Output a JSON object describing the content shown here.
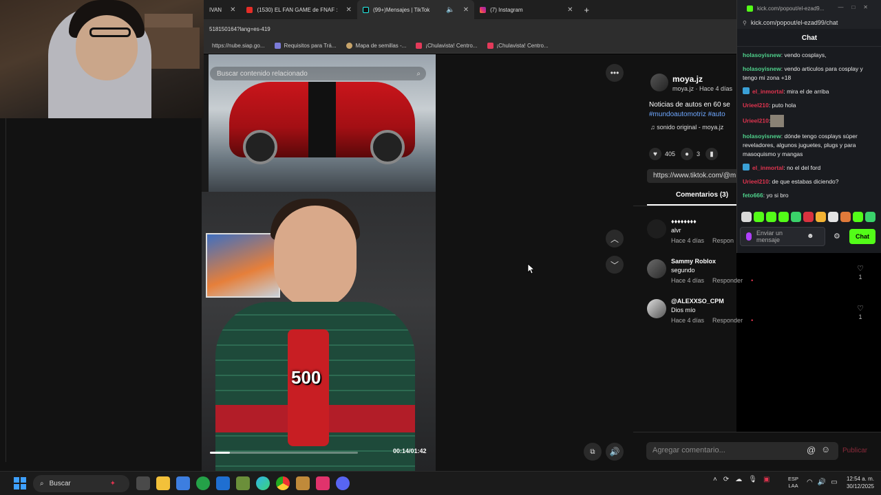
{
  "browser": {
    "tabs": [
      {
        "label": "IVAN",
        "icon": "tab-fragment-icon"
      },
      {
        "label": "(1530) EL FAN GAME de FNAF :",
        "icon": "youtube-icon"
      },
      {
        "label": "(99+)Mensajes | TikTok",
        "icon": "tiktok-icon",
        "active": true
      },
      {
        "label": "(7) Instagram",
        "icon": "instagram-icon"
      }
    ],
    "new_tab": "+",
    "address": "518150164?lang=es-419",
    "bookmarks": [
      {
        "label": "https://nube.siap.go..."
      },
      {
        "label": "Requisitos para Trá..."
      },
      {
        "label": "Mapa de semillas -..."
      },
      {
        "label": "¡Chulavista! Centro..."
      },
      {
        "label": "¡Chulavista! Centro..."
      }
    ]
  },
  "video": {
    "search_placeholder": "Buscar contenido relacionado",
    "overlay_number": "500",
    "time": "00:14/01:42",
    "progress": 0.137
  },
  "post": {
    "author": "moya.jz",
    "author_sub": "moya.jz · Hace 4 días",
    "description": "Noticias de autos en 60 se",
    "hashtags": "#mundoautomotriz #auto",
    "sound": "♫  sonido original - moya.jz",
    "likes": "405",
    "comments": "3",
    "link": "https://www.tiktok.com/@m"
  },
  "comments_panel": {
    "tab_label": "Comentarios (3)",
    "items": [
      {
        "name": "♦♦♦♦♦♦♦♦",
        "text": "alvr",
        "time": "Hace 4 días",
        "reply": "Respon"
      },
      {
        "name": "Sammy Roblox",
        "text": "segundo",
        "time": "Hace 4 días",
        "reply": "Responder",
        "likes": "1"
      },
      {
        "name": "@ALEXXSO_CPM",
        "text": "Dios mío",
        "time": "Hace 4 días",
        "reply": "Responder",
        "likes": "1"
      }
    ],
    "input_placeholder": "Agregar comentario...",
    "publish": "Publicar"
  },
  "kick": {
    "window_title": "kick.com/popout/el-ezad9...",
    "url": "kick.com/popout/el-ezad99/chat",
    "header": "Chat",
    "messages": [
      {
        "user": "holasoyisnew",
        "color": "#4fd18b",
        "text": ": vendo cosplays,"
      },
      {
        "user": "holasoyisnew",
        "color": "#4fd18b",
        "text": ": vendo articulos para cosplay y tengo mi zona +18"
      },
      {
        "user": "el_inmortal",
        "color": "#e0344f",
        "text": ": mira el de arriba",
        "badge": true
      },
      {
        "user": "Urieel210",
        "color": "#e0344f",
        "text": ": puto hola"
      },
      {
        "user": "Urieel210",
        "color": "#e0344f",
        "text": ":",
        "image": true
      },
      {
        "user": "holasoyisnew",
        "color": "#4fd18b",
        "text": ": dónde tengo cosplays súper reveladores, algunos juguetes, plugs y para masoquismo y mangas"
      },
      {
        "user": "el_inmortal",
        "color": "#e0344f",
        "text": ": no el del ford",
        "badge": true
      },
      {
        "user": "Urieel210",
        "color": "#e0344f",
        "text": ": de que estabas diciendo?"
      },
      {
        "user": "feto666",
        "color": "#4fd18b",
        "text": ": yo si bro"
      }
    ],
    "input_placeholder": "Enviar un mensaje",
    "send_label": "Chat"
  },
  "taskbar": {
    "search_label": "Buscar",
    "lang_line1": "ESP",
    "lang_line2": "LAA",
    "time": "12:54 a. m.",
    "date": "30/12/2025"
  }
}
